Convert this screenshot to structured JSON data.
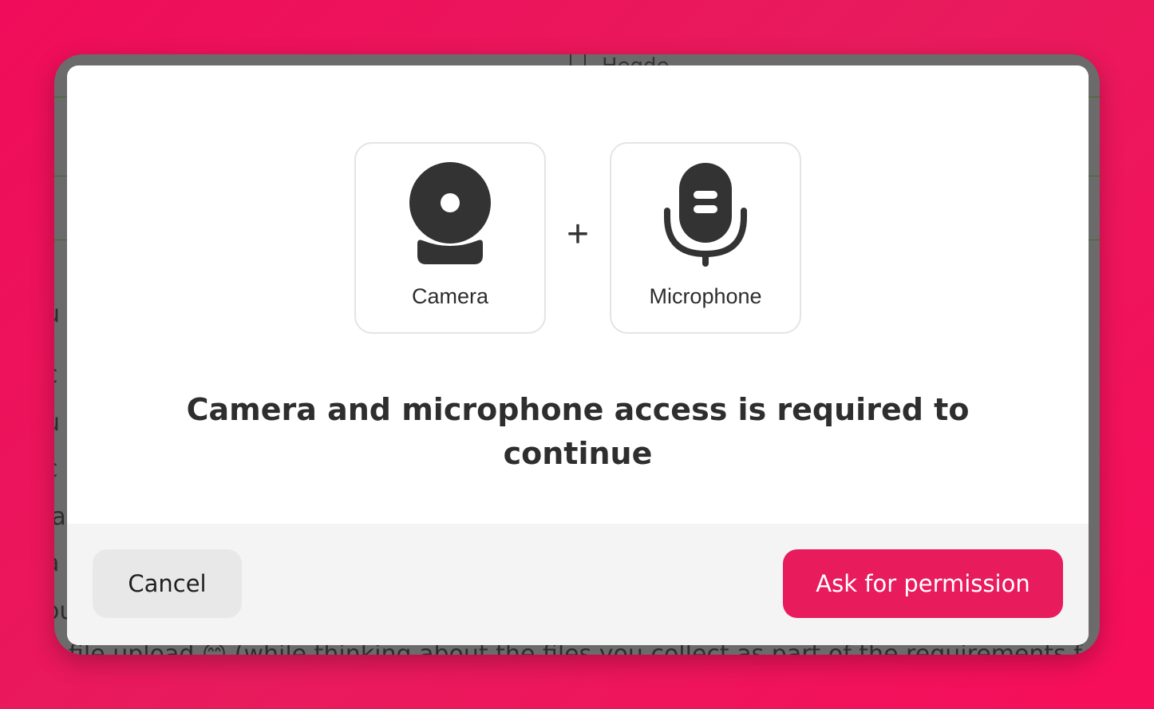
{
  "background": {
    "name_text": "Hegde",
    "fragments": [
      "u",
      "c",
      "u",
      "c",
      "la",
      "a",
      "ou"
    ],
    "bottom_text": "e file upload 😊 (while thinking about the files you collect as part of the requirements f"
  },
  "modal": {
    "devices": [
      {
        "icon": "camera-icon",
        "label": "Camera"
      },
      {
        "icon": "microphone-icon",
        "label": "Microphone"
      }
    ],
    "separator": "+",
    "title": "Camera and microphone access is required to continue",
    "cancel_label": "Cancel",
    "ask_label": "Ask for permission"
  },
  "colors": {
    "accent": "#e81b5d",
    "page_background": "#f00c5a",
    "icon": "#333333"
  }
}
